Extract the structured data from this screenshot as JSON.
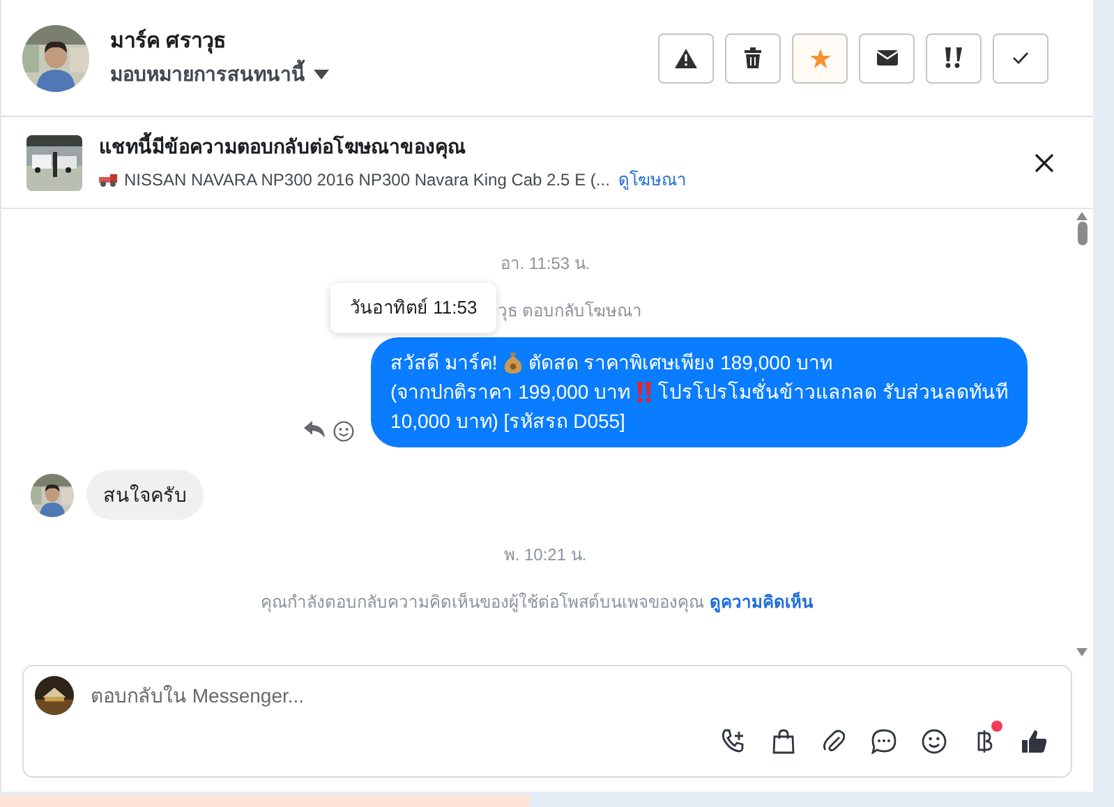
{
  "contact": {
    "name": "มาร์ค ศราวุธ",
    "assign": "มอบหมายการสนทนานี้"
  },
  "actions": [
    {
      "kind": "alert",
      "on": false
    },
    {
      "kind": "trash",
      "on": false
    },
    {
      "kind": "star",
      "on": true
    },
    {
      "kind": "mail",
      "on": false
    },
    {
      "kind": "priority",
      "on": false
    },
    {
      "kind": "check",
      "on": false
    }
  ],
  "ad_banner": {
    "title": "แชทนี้มีข้อความตอบกลับต่อโฆษณาของคุณ",
    "product": "NISSAN NAVARA NP300 2016 NP300 Navara King Cab 2.5 E (...",
    "link": "ดูโฆษณา"
  },
  "messages": [
    {
      "kind": "time",
      "text": "อา. 11:53 น."
    },
    {
      "kind": "notice",
      "text": "วุธ ตอบกลับโฆษณา",
      "tooltip": "วันอาทิตย์ 11:53"
    },
    {
      "kind": "outgoing",
      "lines": [
        [
          {
            "kind": "text",
            "text": "สวัสดี มาร์ค!"
          },
          {
            "kind": "moneybag"
          },
          {
            "kind": "text",
            "text": "ตัดสด ราคาพิเศษเพียง 189,000 บาท"
          }
        ],
        [
          {
            "kind": "text",
            "text": "(จากปกติราคา 199,000 บาท"
          },
          {
            "kind": "bang"
          },
          {
            "kind": "text",
            "text": "โปรโปรโมชั่นข้าวแลกลด รับส่วนลดทันที"
          }
        ],
        [
          {
            "kind": "text",
            "text": "10,000 บาท) [รหัสรถ D055]"
          }
        ]
      ]
    },
    {
      "kind": "incoming",
      "text": "สนใจครับ"
    },
    {
      "kind": "time",
      "text": "พ. 10:21 น."
    },
    {
      "kind": "notice",
      "text": "คุณกำลังตอบกลับความคิดเห็นของผู้ใช้ต่อโพสต์บนเพจของคุณ",
      "link": "ดูความคิดเห็น"
    }
  ],
  "composer": {
    "placeholder": "ตอบกลับใน Messenger...",
    "tools": [
      {
        "kind": "call",
        "notification": false
      },
      {
        "kind": "bag",
        "notification": false
      },
      {
        "kind": "clip",
        "notification": false
      },
      {
        "kind": "chat",
        "notification": false
      },
      {
        "kind": "smile",
        "notification": false
      },
      {
        "kind": "baht",
        "notification": true
      },
      {
        "kind": "like",
        "notification": false
      }
    ]
  }
}
